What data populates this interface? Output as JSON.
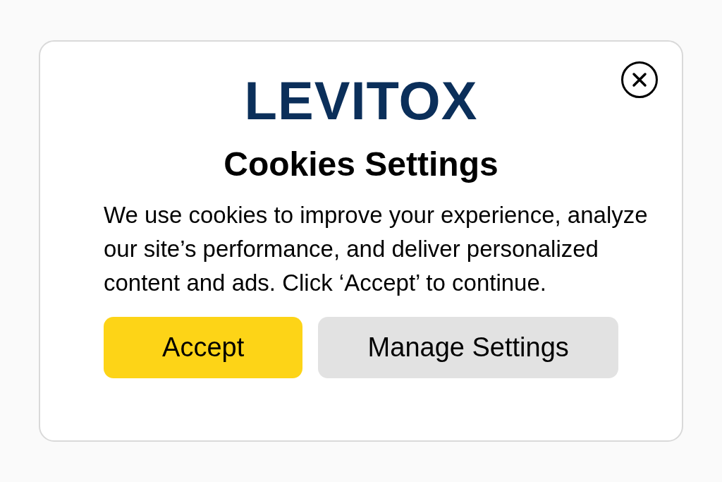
{
  "dialog": {
    "logo": "LEVITOX",
    "title": "Cookies Settings",
    "message": "We use cookies to improve your experience, analyze our site’s performance, and deliver personalized content and ads. Click ‘Accept’ to continue.",
    "buttons": [
      {
        "label": "Accept",
        "kind": "primary"
      },
      {
        "label": "Manage Settings",
        "kind": "secondary"
      }
    ]
  }
}
